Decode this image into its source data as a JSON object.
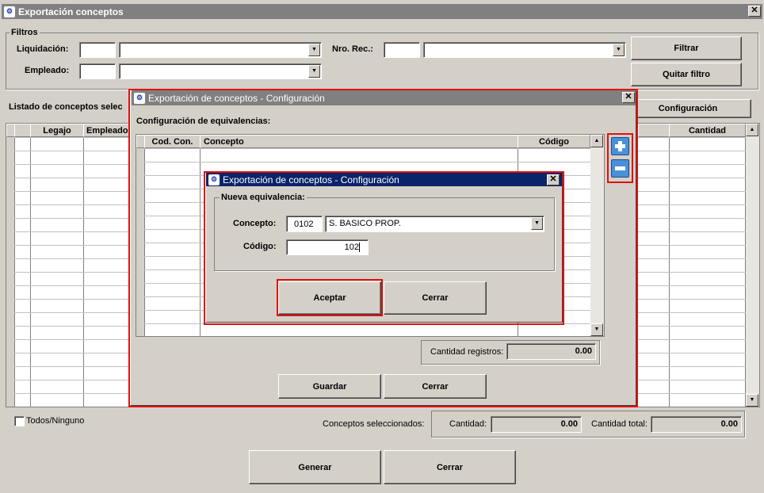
{
  "main": {
    "title": "Exportación conceptos",
    "filters_group": "Filtros",
    "liquidacion_label": "Liquidación:",
    "empleado_label": "Empleado:",
    "nrorec_label": "Nro. Rec.:",
    "filtrar": "Filtrar",
    "quitar_filtro": "Quitar filtro",
    "listado_label": "Listado de conceptos selec",
    "configuracion": "Configuración",
    "col_legajo": "Legajo",
    "col_empleado": "Empleado",
    "col_cantidad": "Cantidad",
    "todos_ninguno": "Todos/Ninguno",
    "conceptos_sel": "Conceptos seleccionados:",
    "cantidad_label": "Cantidad:",
    "cantidad_value": "0.00",
    "cantidad_total_label": "Cantidad total:",
    "cantidad_total_value": "0.00",
    "generar": "Generar",
    "cerrar": "Cerrar"
  },
  "config": {
    "title": "Exportación de conceptos - Configuración",
    "equivalencias_label": "Configuración de equivalencias:",
    "col_cod": "Cod. Con.",
    "col_concepto": "Concepto",
    "col_codigo": "Código",
    "cantidad_registros_label": "Cantidad registros:",
    "cantidad_registros_value": "0.00",
    "guardar": "Guardar",
    "cerrar": "Cerrar"
  },
  "nueva": {
    "title": "Exportación de conceptos - Configuración",
    "group": "Nueva equivalencia:",
    "concepto_label": "Concepto:",
    "concepto_code": "0102",
    "concepto_name": "S. BASICO PROP.",
    "codigo_label": "Código:",
    "codigo_value": "102",
    "aceptar": "Aceptar",
    "cerrar": "Cerrar"
  },
  "icons": {
    "add": "plus-icon",
    "remove": "minus-icon",
    "combo_arrow": "▼",
    "scroll_up": "▲",
    "scroll_down": "▼",
    "close": "✕"
  },
  "colors": {
    "title_inactive": "#808080",
    "title_active": "#0a246a",
    "highlight": "#e01010"
  }
}
